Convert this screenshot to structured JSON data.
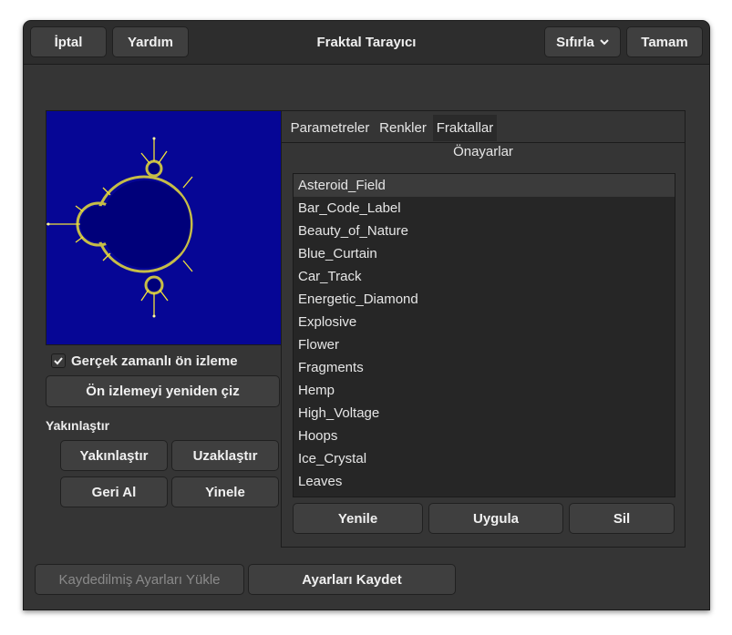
{
  "header": {
    "cancel_label": "İptal",
    "help_label": "Yardım",
    "title": "Fraktal Tarayıcı",
    "reset_label": "Sıfırla",
    "ok_label": "Tamam"
  },
  "preview": {
    "realtime_label": "Gerçek zamanlı ön izleme",
    "realtime_checked": true,
    "redraw_label": "Ön izlemeyi yeniden çiz"
  },
  "zoom": {
    "section_label": "Yakınlaştır",
    "zoom_in_label": "Yakınlaştır",
    "zoom_out_label": "Uzaklaştır",
    "undo_label": "Geri Al",
    "redo_label": "Yinele"
  },
  "tabs": [
    "Parametreler",
    "Renkler",
    "Fraktallar"
  ],
  "active_tab": "Fraktallar",
  "presets": {
    "label": "Önayarlar",
    "items": [
      "Asteroid_Field",
      "Bar_Code_Label",
      "Beauty_of_Nature",
      "Blue_Curtain",
      "Car_Track",
      "Energetic_Diamond",
      "Explosive",
      "Flower",
      "Fragments",
      "Hemp",
      "High_Voltage",
      "Hoops",
      "Ice_Crystal",
      "Leaves"
    ],
    "selected": "Asteroid_Field",
    "refresh_label": "Yenile",
    "apply_label": "Uygula",
    "delete_label": "Sil"
  },
  "footer": {
    "load_label": "Kaydedilmiş Ayarları Yükle",
    "save_label": "Ayarları Kaydet"
  },
  "colors": {
    "window_bg": "#353535",
    "preview_bg": "#0a0a88",
    "fractal_body": "#00007a",
    "fractal_edge": "#f2e23a"
  }
}
